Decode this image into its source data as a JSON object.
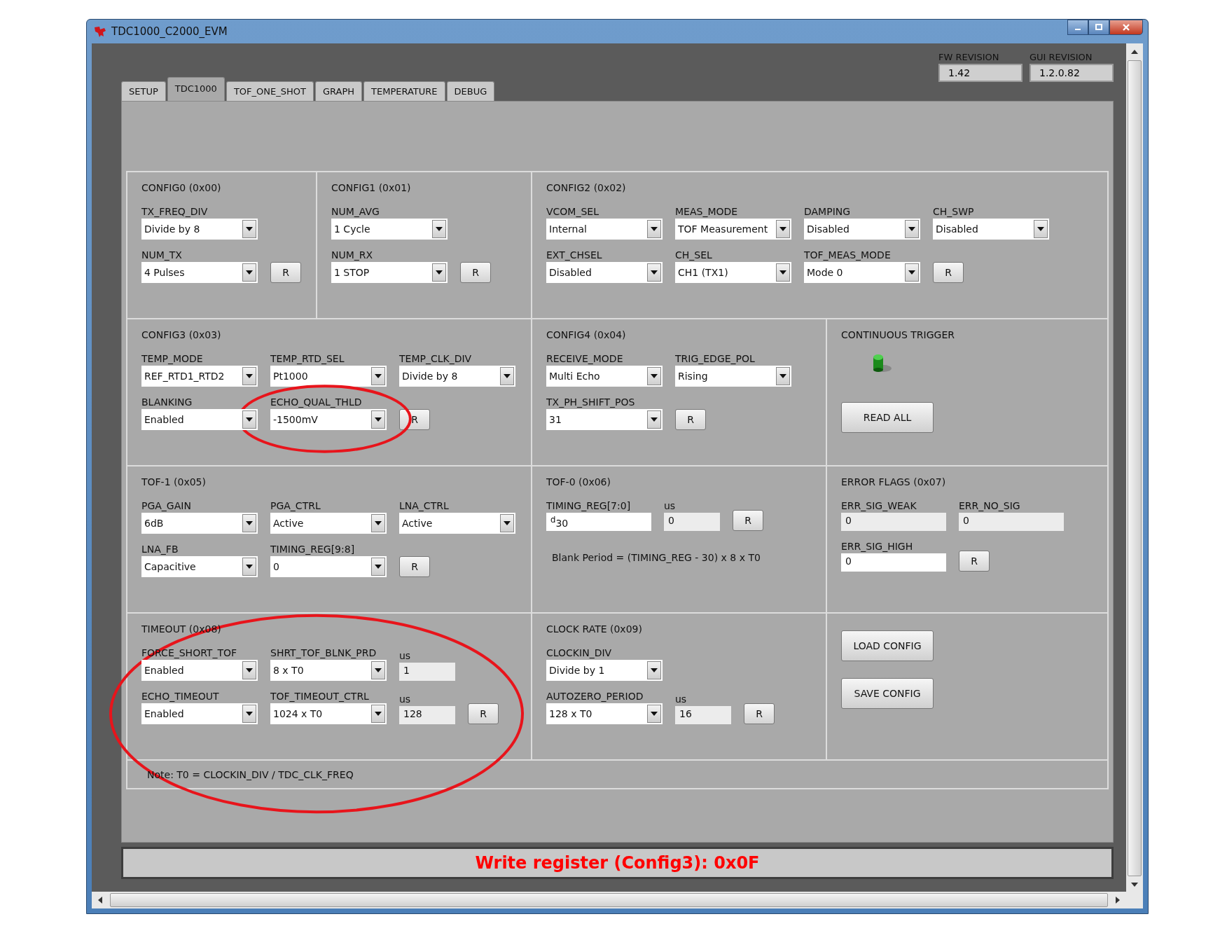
{
  "window": {
    "title": "TDC1000_C2000_EVM"
  },
  "tabs": [
    {
      "label": "SETUP",
      "selected": false
    },
    {
      "label": "TDC1000",
      "selected": true
    },
    {
      "label": "TOF_ONE_SHOT",
      "selected": false
    },
    {
      "label": "GRAPH",
      "selected": false
    },
    {
      "label": "TEMPERATURE",
      "selected": false
    },
    {
      "label": "DEBUG",
      "selected": false
    }
  ],
  "revisions": [
    {
      "label": "FW REVISION",
      "value": "1.42"
    },
    {
      "label": "GUI REVISION",
      "value": "1.2.0.82"
    }
  ],
  "panel_rows": [
    [
      {
        "title": "CONFIG0 (0x00)",
        "circled": false,
        "rows": [
          [
            {
              "kind": "dropdown",
              "label": "TX_FREQ_DIV",
              "value": "Divide by 8"
            }
          ],
          [
            {
              "kind": "dropdown",
              "label": "NUM_TX",
              "value": "4 Pulses"
            },
            {
              "kind": "reset",
              "label": "R"
            }
          ]
        ]
      },
      {
        "title": "CONFIG1 (0x01)",
        "circled": false,
        "rows": [
          [
            {
              "kind": "dropdown",
              "label": "NUM_AVG",
              "value": "1 Cycle"
            }
          ],
          [
            {
              "kind": "dropdown",
              "label": "NUM_RX",
              "value": "1 STOP"
            },
            {
              "kind": "reset",
              "label": "R"
            }
          ]
        ]
      },
      {
        "title": "CONFIG2 (0x02)",
        "circled": false,
        "rows": [
          [
            {
              "kind": "dropdown",
              "label": "VCOM_SEL",
              "value": "Internal"
            },
            {
              "kind": "dropdown",
              "label": "MEAS_MODE",
              "value": "TOF Measurement"
            },
            {
              "kind": "dropdown",
              "label": "DAMPING",
              "value": "Disabled"
            },
            {
              "kind": "dropdown",
              "label": "CH_SWP",
              "value": "Disabled"
            }
          ],
          [
            {
              "kind": "dropdown",
              "label": "EXT_CHSEL",
              "value": "Disabled"
            },
            {
              "kind": "dropdown",
              "label": "CH_SEL",
              "value": "CH1 (TX1)"
            },
            {
              "kind": "dropdown",
              "label": "TOF_MEAS_MODE",
              "value": "Mode 0"
            },
            {
              "kind": "reset",
              "label": "R"
            }
          ]
        ]
      }
    ],
    [
      {
        "title": "CONFIG3 (0x03)",
        "circled": false,
        "rows": [
          [
            {
              "kind": "dropdown",
              "label": "TEMP_MODE",
              "value": "REF_RTD1_RTD2"
            },
            {
              "kind": "dropdown",
              "label": "TEMP_RTD_SEL",
              "value": "Pt1000"
            },
            {
              "kind": "dropdown",
              "label": "TEMP_CLK_DIV",
              "value": "Divide by 8"
            }
          ],
          [
            {
              "kind": "dropdown",
              "label": "BLANKING",
              "value": "Enabled"
            },
            {
              "kind": "dropdown",
              "label": "ECHO_QUAL_THLD",
              "value": "-1500mV",
              "circled": true
            },
            {
              "kind": "reset",
              "label": "R"
            }
          ]
        ]
      },
      {
        "title": "CONFIG4 (0x04)",
        "circled": false,
        "rows": [
          [
            {
              "kind": "dropdown",
              "label": "RECEIVE_MODE",
              "value": "Multi Echo"
            },
            {
              "kind": "dropdown",
              "label": "TRIG_EDGE_POL",
              "value": "Rising"
            }
          ],
          [
            {
              "kind": "dropdown",
              "label": "TX_PH_SHIFT_POS",
              "value": "31"
            },
            {
              "kind": "reset",
              "label": "R"
            }
          ]
        ]
      },
      {
        "title": "CONTINUOUS TRIGGER",
        "circled": false,
        "rows": [
          [
            {
              "kind": "led",
              "on": true
            }
          ],
          [
            {
              "kind": "action",
              "label": "READ ALL"
            }
          ]
        ]
      }
    ],
    [
      {
        "title": "TOF-1 (0x05)",
        "circled": false,
        "rows": [
          [
            {
              "kind": "dropdown",
              "label": "PGA_GAIN",
              "value": "6dB"
            },
            {
              "kind": "dropdown",
              "label": "PGA_CTRL",
              "value": "Active"
            },
            {
              "kind": "dropdown",
              "label": "LNA_CTRL",
              "value": "Active"
            }
          ],
          [
            {
              "kind": "dropdown",
              "label": "LNA_FB",
              "value": "Capacitive"
            },
            {
              "kind": "dropdown",
              "label": "TIMING_REG[9:8]",
              "value": "0"
            },
            {
              "kind": "reset",
              "label": "R"
            }
          ]
        ]
      },
      {
        "title": "TOF-0 (0x06)",
        "circled": false,
        "rows": [
          [
            {
              "kind": "entry",
              "label": "TIMING_REG[7:0]",
              "value": "$^{d}$30"
            },
            {
              "kind": "readout",
              "label": "us",
              "value": "0"
            },
            {
              "kind": "reset",
              "label": "R"
            }
          ],
          [
            {
              "kind": "text",
              "text": "Blank Period = (TIMING_REG - 30) x 8 x T0"
            }
          ]
        ]
      },
      {
        "title": "ERROR FLAGS (0x07)",
        "circled": false,
        "rows": [
          [
            {
              "kind": "readout",
              "label": "ERR_SIG_WEAK",
              "value": "0"
            },
            {
              "kind": "readout",
              "label": "ERR_NO_SIG",
              "value": "0"
            }
          ],
          [
            {
              "kind": "entry",
              "label": "ERR_SIG_HIGH",
              "value": "0"
            },
            {
              "kind": "reset",
              "label": "R"
            }
          ]
        ]
      }
    ],
    [
      {
        "title": "TIMEOUT (0x08)",
        "circled": true,
        "rows": [
          [
            {
              "kind": "dropdown",
              "label": "FORCE_SHORT_TOF",
              "value": "Enabled"
            },
            {
              "kind": "dropdown",
              "label": "SHRT_TOF_BLNK_PRD",
              "value": "8 x T0"
            },
            {
              "kind": "readout",
              "label": "us",
              "value": "1"
            }
          ],
          [
            {
              "kind": "dropdown",
              "label": "ECHO_TIMEOUT",
              "value": "Enabled"
            },
            {
              "kind": "dropdown",
              "label": "TOF_TIMEOUT_CTRL",
              "value": "1024 x T0"
            },
            {
              "kind": "readout",
              "label": "us",
              "value": "128"
            },
            {
              "kind": "reset",
              "label": "R"
            }
          ]
        ]
      },
      {
        "title": "CLOCK RATE (0x09)",
        "circled": false,
        "rows": [
          [
            {
              "kind": "dropdown",
              "label": "CLOCKIN_DIV",
              "value": "Divide by 1"
            }
          ],
          [
            {
              "kind": "dropdown",
              "label": "AUTOZERO_PERIOD",
              "value": "128 x T0"
            },
            {
              "kind": "readout",
              "label": "us",
              "value": "16"
            },
            {
              "kind": "reset",
              "label": "R"
            }
          ]
        ]
      },
      {
        "circled": false,
        "rows": [
          [
            {
              "kind": "action",
              "label": "LOAD CONFIG"
            }
          ],
          [
            {
              "kind": "action",
              "label": "SAVE CONFIG"
            }
          ]
        ]
      }
    ]
  ],
  "note": {
    "text": "Note: T0 = CLOCKIN_DIV / TDC_CLK_FREQ"
  },
  "status_bar": {
    "text": "Write register (Config3): 0x0F"
  }
}
